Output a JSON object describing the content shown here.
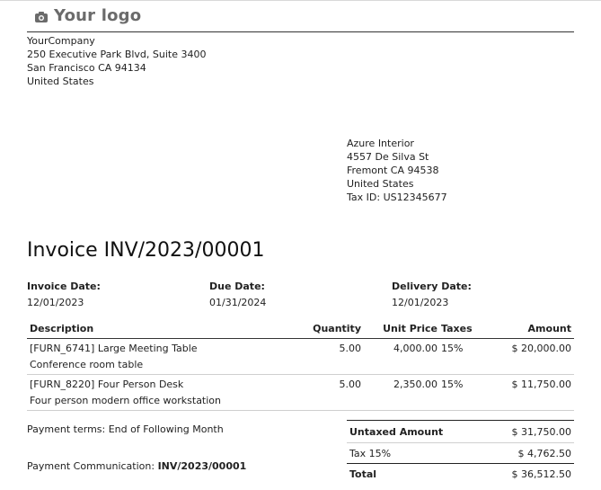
{
  "logo": {
    "text": "Your logo",
    "icon": "camera-icon"
  },
  "company": {
    "name": "YourCompany",
    "street": "250 Executive Park Blvd, Suite 3400",
    "city": "San Francisco CA 94134",
    "country": "United States"
  },
  "partner": {
    "name": "Azure Interior",
    "street": "4557 De Silva St",
    "city": "Fremont CA 94538",
    "country": "United States",
    "tax_id": "Tax ID: US12345677"
  },
  "invoice": {
    "title": "Invoice INV/2023/00001",
    "invoice_date_label": "Invoice Date:",
    "invoice_date": "12/01/2023",
    "due_date_label": "Due Date:",
    "due_date": "01/31/2024",
    "delivery_date_label": "Delivery Date:",
    "delivery_date": "12/01/2023"
  },
  "table": {
    "headers": {
      "description": "Description",
      "quantity": "Quantity",
      "unit_price": "Unit Price",
      "taxes": "Taxes",
      "amount": "Amount"
    },
    "rows": [
      {
        "product": "[FURN_6741] Large Meeting Table",
        "detail": "Conference room table",
        "quantity": "5.00",
        "unit_price": "4,000.00",
        "taxes": "15%",
        "amount": "$ 20,000.00"
      },
      {
        "product": "[FURN_8220] Four Person Desk",
        "detail": "Four person modern office workstation",
        "quantity": "5.00",
        "unit_price": "2,350.00",
        "taxes": "15%",
        "amount": "$ 11,750.00"
      }
    ]
  },
  "payment": {
    "terms": "Payment terms: End of Following Month",
    "communication_label": "Payment Communication: ",
    "communication_value": "INV/2023/00001"
  },
  "totals": {
    "untaxed_label": "Untaxed Amount",
    "untaxed_value": "$ 31,750.00",
    "tax_label": "Tax 15%",
    "tax_value": "$ 4,762.50",
    "total_label": "Total",
    "total_value": "$ 36,512.50"
  }
}
